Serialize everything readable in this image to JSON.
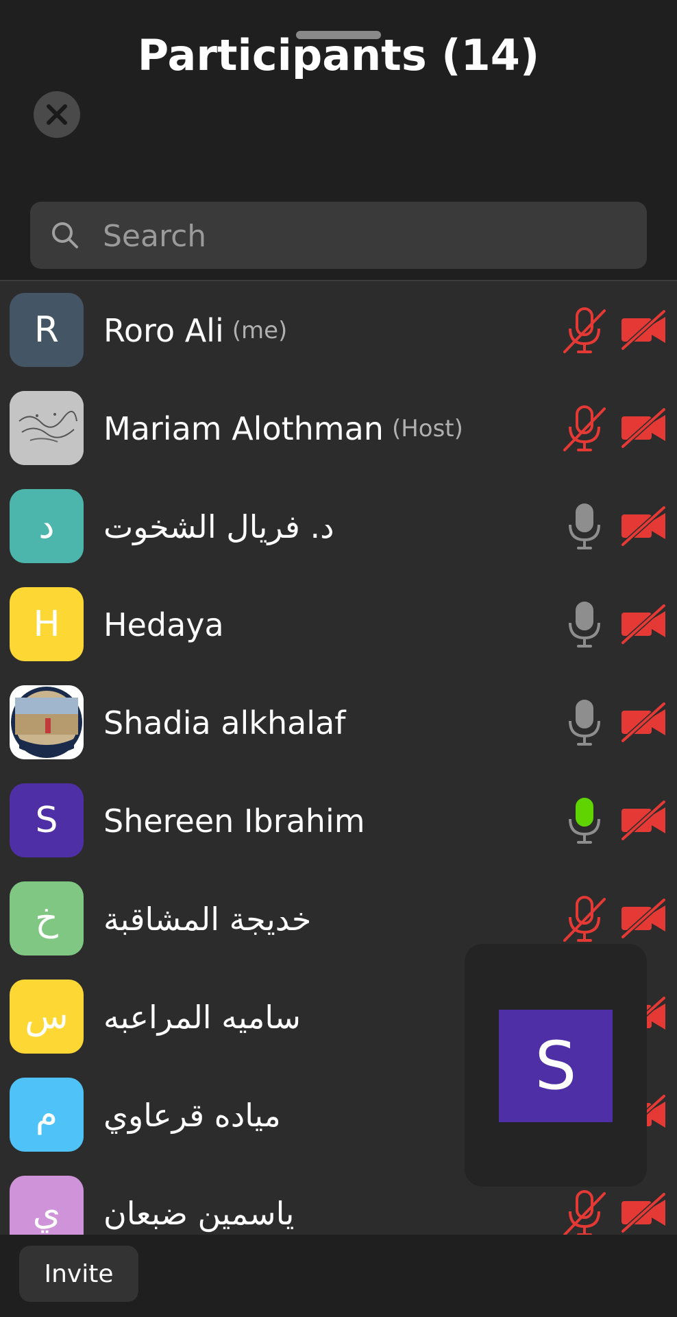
{
  "header": {
    "title": "Participants (14)"
  },
  "search": {
    "placeholder": "Search",
    "value": ""
  },
  "participants": [
    {
      "initial": "R",
      "name": "Roro Ali",
      "tag": "(me)",
      "avatar_color": "#445566",
      "mic": "muted",
      "video": "off"
    },
    {
      "initial": "",
      "name": "Mariam Alothman",
      "tag": "(Host)",
      "avatar_color": "#c4c4c4",
      "avatar_type": "calligraphy-image",
      "mic": "muted",
      "video": "off"
    },
    {
      "initial": "د",
      "name": "د. فريال الشخوت",
      "tag": "",
      "avatar_color": "#4db6ac",
      "mic": "idle",
      "video": "off"
    },
    {
      "initial": "H",
      "name": "Hedaya",
      "tag": "",
      "avatar_color": "#fdd835",
      "mic": "idle",
      "video": "off"
    },
    {
      "initial": "",
      "name": "Shadia alkhalaf",
      "tag": "",
      "avatar_color": "#7d8a9e",
      "avatar_type": "photo",
      "mic": "idle",
      "video": "off"
    },
    {
      "initial": "S",
      "name": "Shereen Ibrahim",
      "tag": "",
      "avatar_color": "#4f2fa5",
      "mic": "speaking",
      "video": "off"
    },
    {
      "initial": "خ",
      "name": "خديجة المشاقبة",
      "tag": "",
      "avatar_color": "#81c784",
      "mic": "muted",
      "video": "off"
    },
    {
      "initial": "س",
      "name": "ساميه المراعبه",
      "tag": "",
      "avatar_color": "#fdd835",
      "mic": "muted",
      "video": "off"
    },
    {
      "initial": "م",
      "name": "مياده قرعاوي",
      "tag": "",
      "avatar_color": "#4fc3f7",
      "mic": "muted",
      "video": "off"
    },
    {
      "initial": "ي",
      "name": "ياسمين ضبعان",
      "tag": "",
      "avatar_color": "#ce93d8",
      "mic": "muted",
      "video": "off"
    }
  ],
  "floating_video": {
    "initial": "S",
    "avatar_color": "#4f2fa5"
  },
  "footer": {
    "invite_label": "Invite"
  },
  "colors": {
    "muted_red": "#e53935",
    "idle_gray": "#8e8e8e",
    "speaking_green": "#5fd400",
    "background": "#1f1f1f",
    "list_background": "#2c2c2c"
  },
  "icons": {
    "close": "close-icon",
    "search": "search-icon",
    "mic_muted": "mic-off-icon",
    "mic": "mic-icon",
    "video_off": "video-off-icon"
  }
}
